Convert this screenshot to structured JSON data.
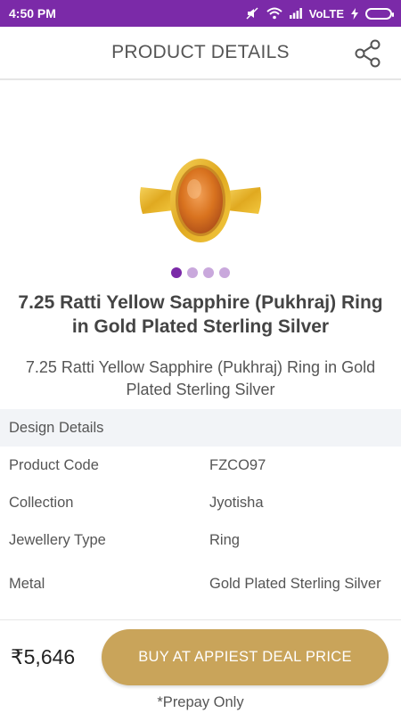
{
  "status_bar": {
    "time": "4:50 PM",
    "network": "VoLTE"
  },
  "header": {
    "title": "PRODUCT DETAILS",
    "share_icon": "share-icon"
  },
  "carousel": {
    "count": 4,
    "active_index": 0
  },
  "product": {
    "name": "7.25 Ratti Yellow Sapphire (Pukhraj) Ring in Gold Plated Sterling Silver",
    "description": "7.25 Ratti Yellow Sapphire (Pukhraj) Ring in Gold Plated Sterling Silver"
  },
  "design_details": {
    "heading": "Design Details",
    "rows": [
      {
        "label": "Product Code",
        "value": "FZCO97"
      },
      {
        "label": "Collection",
        "value": "Jyotisha"
      },
      {
        "label": "Jewellery Type",
        "value": "Ring"
      },
      {
        "label": "Metal",
        "value": "Gold Plated Sterling Silver"
      }
    ]
  },
  "purchase": {
    "price": "₹5,646",
    "buy_label": "BUY AT APPIEST DEAL PRICE",
    "note": "*Prepay Only"
  },
  "colors": {
    "accent": "#7b2aa8",
    "button": "#c9a45a"
  }
}
